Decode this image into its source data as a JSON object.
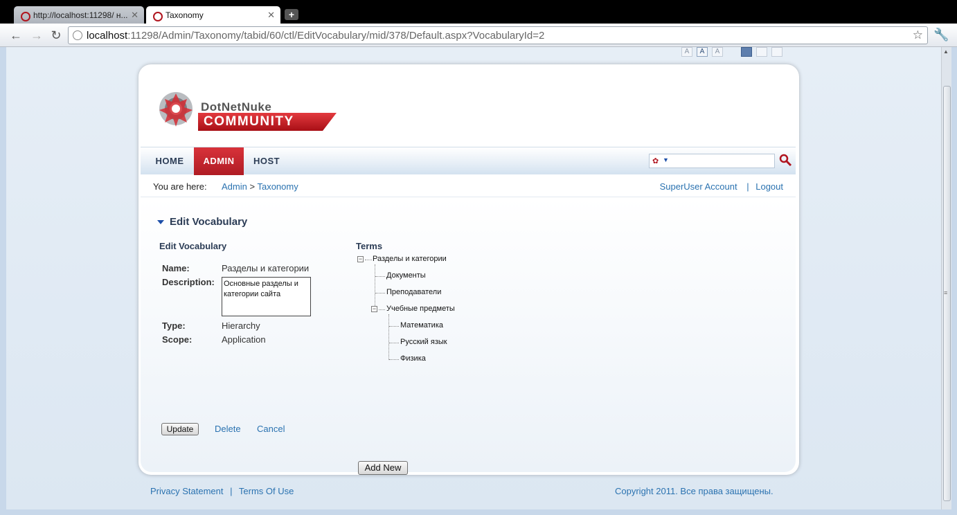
{
  "browser": {
    "tabs": [
      {
        "title": "http://localhost:11298/ н...",
        "active": false
      },
      {
        "title": "Taxonomy",
        "active": true
      }
    ],
    "url_host": "localhost",
    "url_rest": ":11298/Admin/Taxonomy/tabid/60/ctl/EditVocabulary/mid/378/Default.aspx?VocabularyId=2"
  },
  "size_controls": [
    "A",
    "A",
    "A"
  ],
  "logo": {
    "line1": "DotNetNuke",
    "line2": "COMMUNITY"
  },
  "menu": [
    "HOME",
    "ADMIN",
    "HOST"
  ],
  "breadcrumb": {
    "prefix": "You are here:",
    "items": [
      "Admin",
      "Taxonomy"
    ],
    "separator": ">"
  },
  "account": {
    "user": "SuperUser Account",
    "separator": "|",
    "logout": "Logout"
  },
  "module": {
    "title": "Edit Vocabulary",
    "section": "Edit Vocabulary",
    "name_label": "Name:",
    "name_value": "Разделы и категории",
    "description_label": "Description:",
    "description_value": "Основные разделы и категории сайта",
    "type_label": "Type:",
    "type_value": "Hierarchy",
    "scope_label": "Scope:",
    "scope_value": "Application",
    "update_label": "Update",
    "delete_label": "Delete",
    "cancel_label": "Cancel"
  },
  "terms": {
    "title": "Terms",
    "root": "Разделы и категории",
    "level1": [
      "Документы",
      "Преподаватели",
      "Учебные предметы"
    ],
    "level2": [
      "Математика",
      "Русский язык",
      "Физика"
    ],
    "add_new_label": "Add New"
  },
  "footer": {
    "privacy": "Privacy Statement",
    "separator": "|",
    "terms": "Terms Of Use",
    "copyright": "Copyright 2011. Все права защищены."
  },
  "colors": {
    "accent": "#b01c24",
    "link": "#2a72b0",
    "heading": "#2b3c55"
  }
}
